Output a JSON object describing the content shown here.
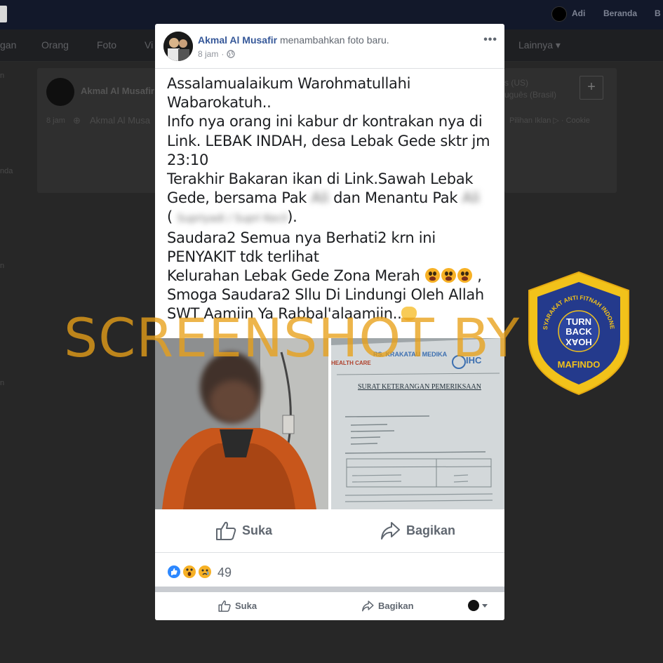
{
  "topbar": {
    "user_name": "Adi",
    "home_link": "Beranda",
    "edge_link": "B"
  },
  "profile_nav": {
    "items": [
      "gan",
      "Orang",
      "Foto",
      "Vi",
      "Lainnya"
    ]
  },
  "background_feed": {
    "author": "Akmal Al Musafir",
    "time": "8 jam",
    "author_repeat": "Akmal Al Musa",
    "language_1": "s (US)",
    "language_2": "uguês (Brasil)",
    "footer_links": "Pilihan Iklan ▷ · Cookie",
    "left_fragments": [
      "n",
      "nda",
      "n",
      "n"
    ]
  },
  "post": {
    "author": "Akmal Al Musafir",
    "action_text": "menambahkan foto baru.",
    "time": "8 jam",
    "more_label": "•••",
    "body_lines": [
      "Assalamualaikum Warohmatullahi",
      "Wabarokatuh..",
      "Info nya orang ini kabur dr kontrakan nya di",
      "Link. LEBAK INDAH, desa Lebak Gede sktr jm",
      "23:10",
      "Terakhir Bakaran ikan di Link.Sawah Lebak",
      "Gede, bersama Pak",
      "dan Menantu Pak",
      "(",
      ").",
      "Saudara2 Semua nya Berhati2 krn ini",
      "PENYAKIT tdk terlihat",
      "Kelurahan Lebak Gede Zona Merah",
      ",",
      "Smoga Saudara2 Sllu Di Lindungi Oleh Allah",
      "SWT Aamiin Ya Rabbal'alaamiin.."
    ],
    "redacted": [
      "Ali",
      "Ali",
      "Supriyadi / Supri Kecil"
    ],
    "doc_header": "RS. KRAKATAU MEDIKA",
    "doc_logo_left": "HEALTH CARE",
    "doc_logo_right": "IHC",
    "doc_title": "SURAT KETERANGAN PEMERIKSAAN",
    "like_label": "Suka",
    "share_label": "Bagikan",
    "reaction_count": "49",
    "bottom_like_label": "Suka",
    "bottom_share_label": "Bagikan"
  },
  "overlay": {
    "watermark": "SCREENSHOT BY",
    "badge_ring_text": "MASYARAKAT ANTI FITNAH INDONESIA",
    "badge_center": [
      "TURN",
      "BACK",
      "HOAX"
    ],
    "badge_bottom": "MAFINDO"
  },
  "colors": {
    "link_blue": "#365899",
    "watermark_orange": "#e8a018",
    "badge_navy": "#243a8c",
    "badge_gold": "#f2c21a"
  }
}
